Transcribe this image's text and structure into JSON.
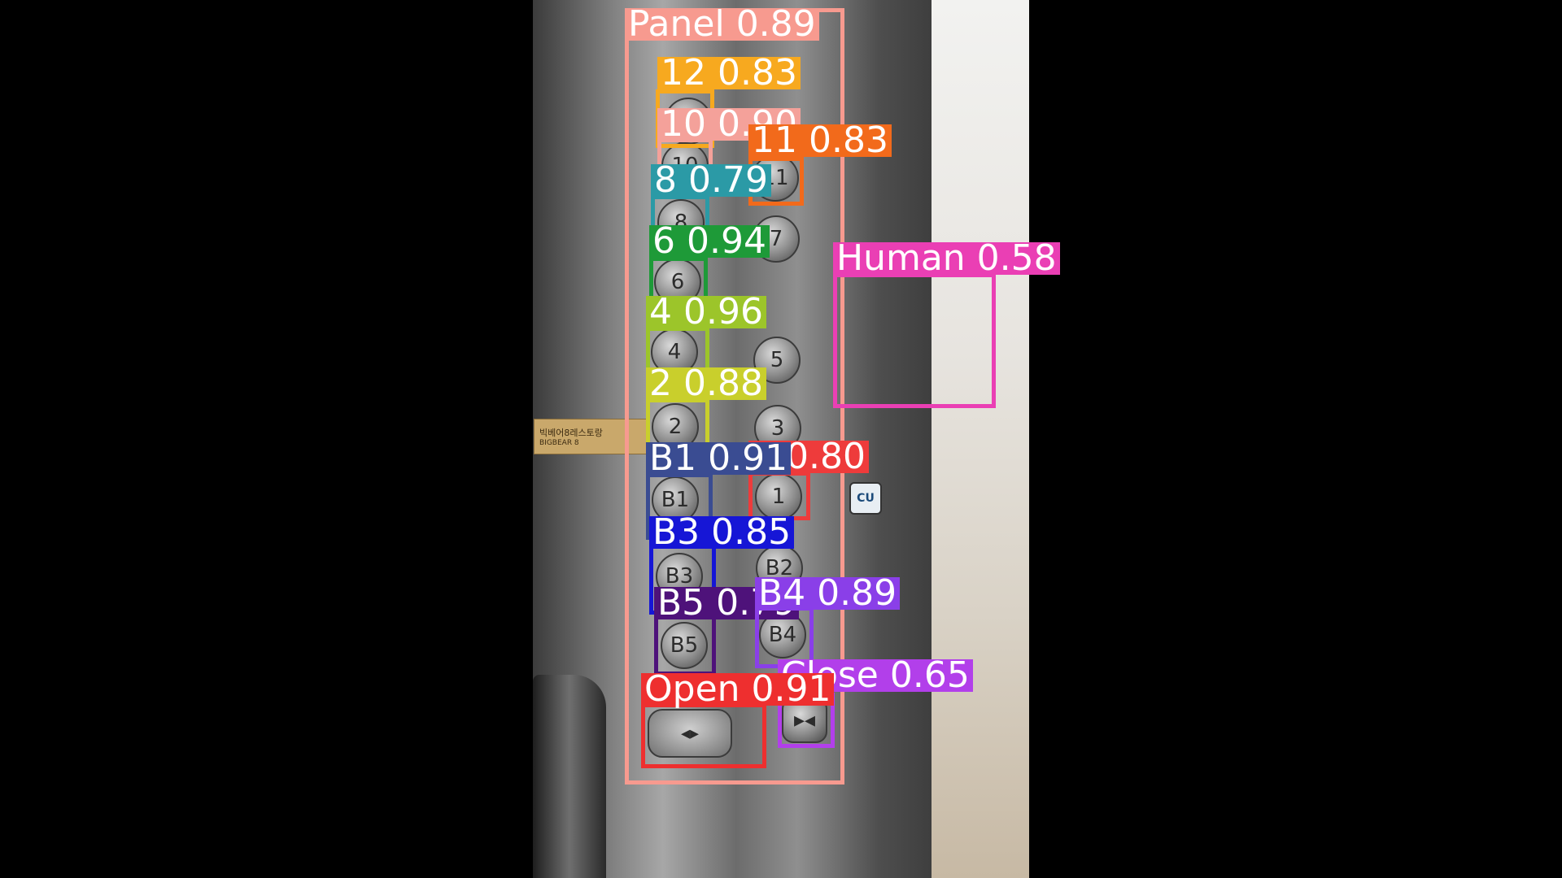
{
  "detections": [
    {
      "label": "Panel",
      "score": "0.89",
      "color": "#F79A8F",
      "text": "Panel 0.89"
    },
    {
      "label": "12",
      "score": "0.83",
      "color": "#F7A91F",
      "text": "12 0.83"
    },
    {
      "label": "10",
      "score": "0.90",
      "color": "#F4A19A",
      "text": "10 0.90"
    },
    {
      "label": "11",
      "score": "0.83",
      "color": "#F26A1B",
      "text": "11 0.83"
    },
    {
      "label": "8",
      "score": "0.79",
      "color": "#2B9AA6",
      "text": "8 0.79"
    },
    {
      "label": "6",
      "score": "0.94",
      "color": "#1E9A38",
      "text": "6 0.94"
    },
    {
      "label": "Human",
      "score": "0.58",
      "color": "#EA3FB4",
      "text": "Human 0.58"
    },
    {
      "label": "4",
      "score": "0.96",
      "color": "#9CC52A",
      "text": "4 0.96"
    },
    {
      "label": "2",
      "score": "0.88",
      "color": "#C9CF2C",
      "text": "2 0.88"
    },
    {
      "label": "1",
      "score": "0.80",
      "color": "#EE3B3B",
      "text": "1 0.80"
    },
    {
      "label": "B1",
      "score": "0.91",
      "color": "#3A4C92",
      "text": "B1 0.91"
    },
    {
      "label": "B3",
      "score": "0.85",
      "color": "#1616D6",
      "text": "B3 0.85"
    },
    {
      "label": "B5",
      "score": "0.79",
      "color": "#4E127A",
      "text": "B5 0.79"
    },
    {
      "label": "B4",
      "score": "0.89",
      "color": "#8A3FE8",
      "text": "B4 0.89"
    },
    {
      "label": "Close",
      "score": "0.65",
      "color": "#B23FEA",
      "text": "Close 0.65"
    },
    {
      "label": "Open",
      "score": "0.91",
      "color": "#EE2F2F",
      "text": "Open 0.91"
    }
  ],
  "buttons": [
    "12",
    "10",
    "11",
    "8",
    "6",
    "7",
    "4",
    "5",
    "2",
    "3",
    "B1",
    "1",
    "B3",
    "B2",
    "B5",
    "B4"
  ],
  "sticker_text": "빅베어8레스토랑",
  "sticker_brand": "BIGBEAR 8",
  "cu_label": "CU"
}
